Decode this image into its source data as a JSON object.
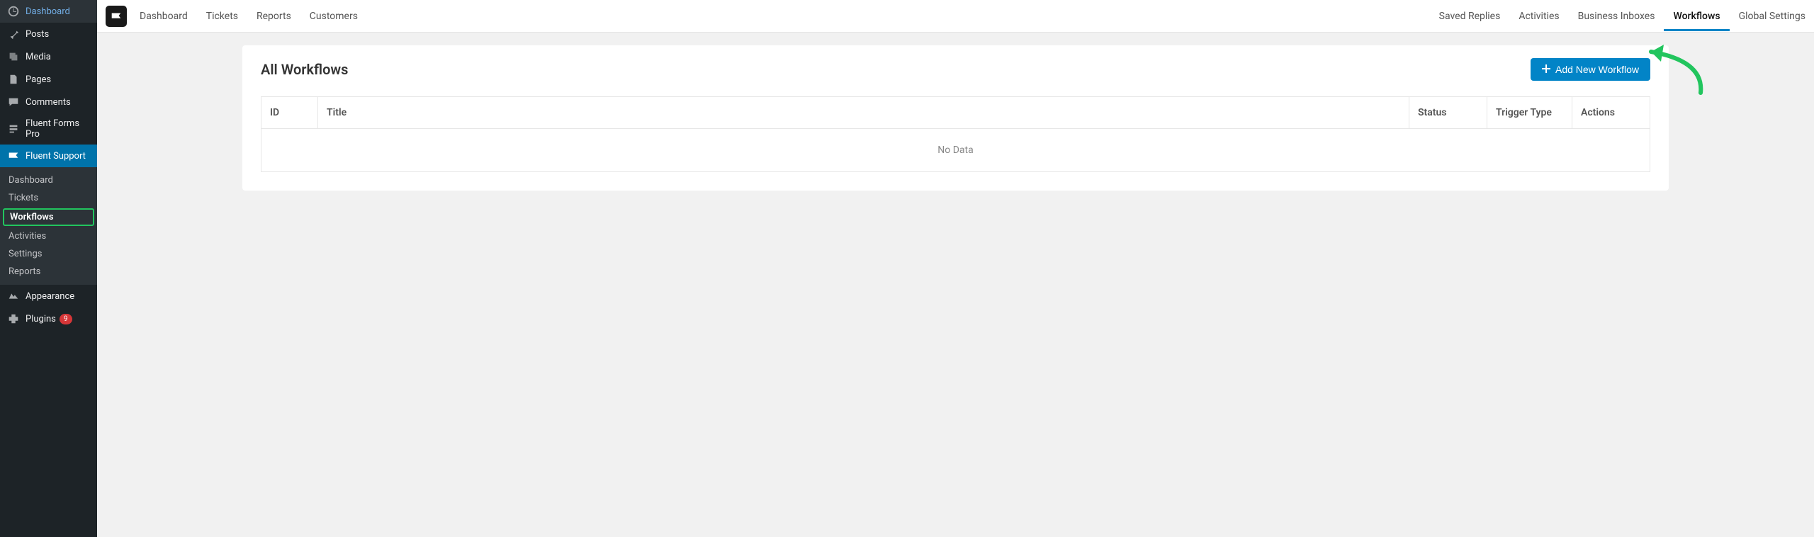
{
  "wp_sidebar": {
    "items": [
      {
        "label": "Dashboard",
        "icon": "dashboard"
      },
      {
        "label": "Posts",
        "icon": "pin"
      },
      {
        "label": "Media",
        "icon": "media"
      },
      {
        "label": "Pages",
        "icon": "pages"
      },
      {
        "label": "Comments",
        "icon": "comments"
      },
      {
        "label": "Fluent Forms Pro",
        "icon": "forms"
      },
      {
        "label": "Fluent Support",
        "icon": "support",
        "active": true
      }
    ],
    "submenu": [
      {
        "label": "Dashboard"
      },
      {
        "label": "Tickets"
      },
      {
        "label": "Workflows",
        "highlighted": true
      },
      {
        "label": "Activities"
      },
      {
        "label": "Settings"
      },
      {
        "label": "Reports"
      }
    ],
    "items_after": [
      {
        "label": "Appearance",
        "icon": "appearance"
      },
      {
        "label": "Plugins",
        "icon": "plugins",
        "badge": "9"
      }
    ]
  },
  "topnav": {
    "left": [
      {
        "label": "Dashboard"
      },
      {
        "label": "Tickets"
      },
      {
        "label": "Reports"
      },
      {
        "label": "Customers"
      }
    ],
    "right": [
      {
        "label": "Saved Replies"
      },
      {
        "label": "Activities"
      },
      {
        "label": "Business Inboxes"
      },
      {
        "label": "Workflows",
        "active": true
      },
      {
        "label": "Global Settings"
      }
    ]
  },
  "page": {
    "title": "All Workflows",
    "add_button": "Add New Workflow",
    "columns": {
      "id": "ID",
      "title": "Title",
      "status": "Status",
      "trigger": "Trigger Type",
      "actions": "Actions"
    },
    "empty": "No Data"
  }
}
